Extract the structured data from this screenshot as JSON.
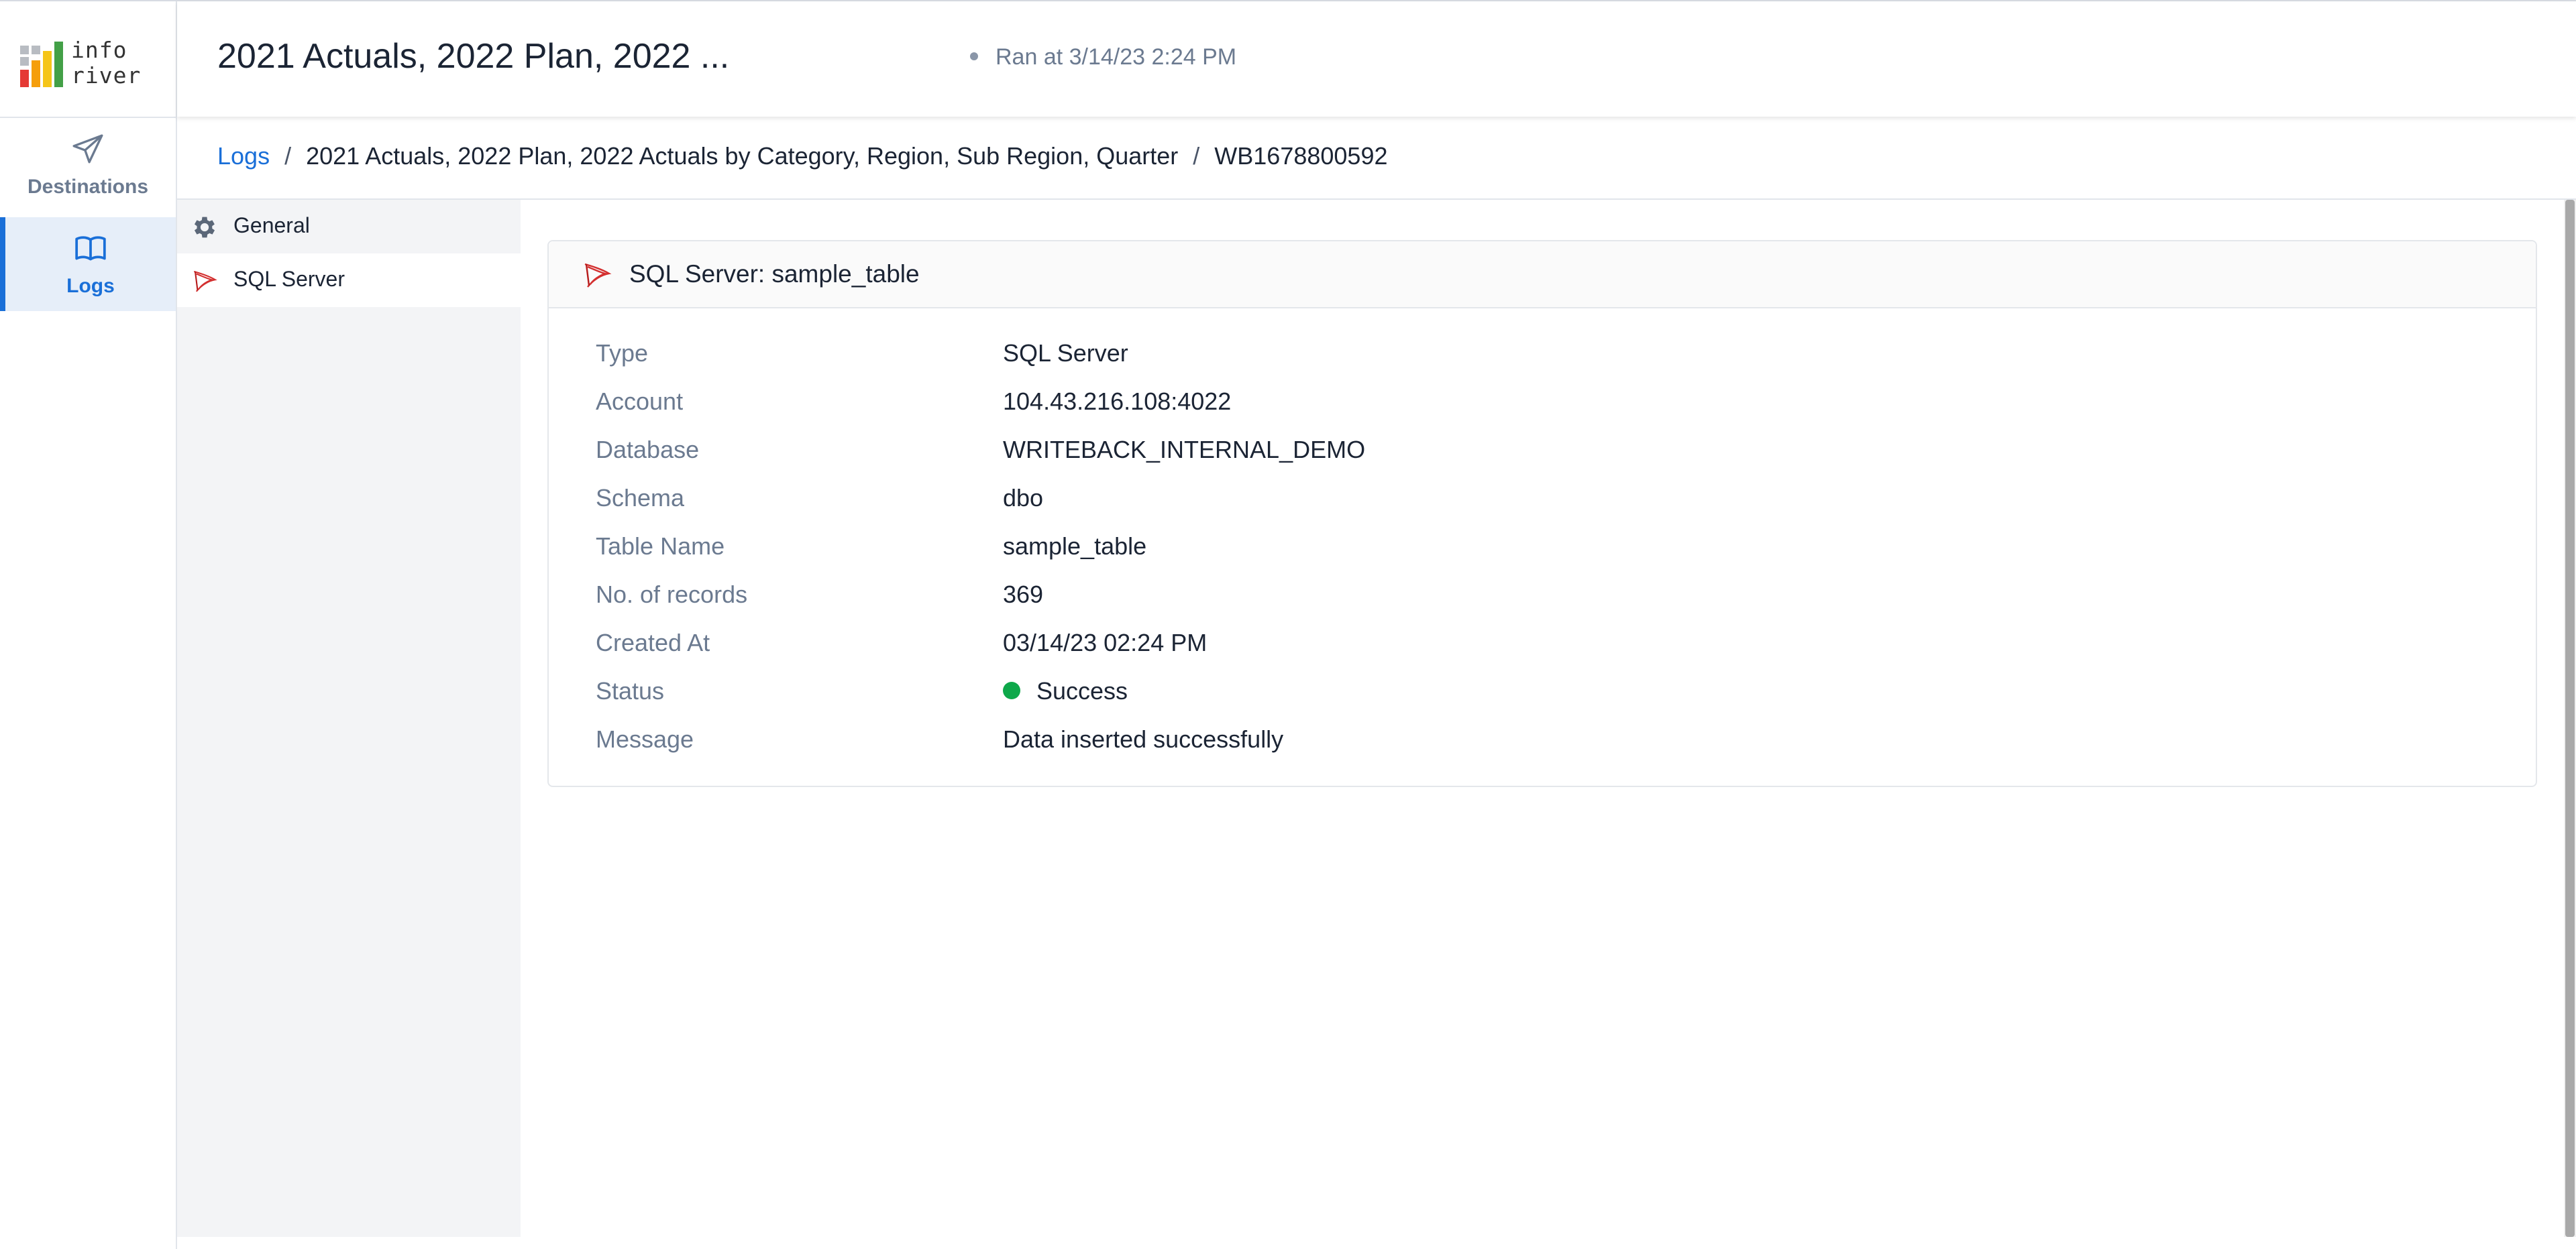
{
  "app": {
    "logo_text_line1": "info",
    "logo_text_line2": "river"
  },
  "rail": {
    "items": [
      {
        "label": "Destinations",
        "icon": "send-icon",
        "active": false
      },
      {
        "label": "Logs",
        "icon": "book-icon",
        "active": true
      }
    ]
  },
  "header": {
    "title": "2021 Actuals, 2022 Plan, 2022 ...",
    "ran_at": "Ran at 3/14/23 2:24 PM"
  },
  "breadcrumb": {
    "root": "Logs",
    "report": "2021 Actuals, 2022 Plan, 2022 Actuals by Category, Region, Sub Region, Quarter",
    "run_id": "WB1678800592"
  },
  "subnav": {
    "items": [
      {
        "label": "General",
        "icon": "gear-icon",
        "selected": false
      },
      {
        "label": "SQL Server",
        "icon": "sql-server-icon",
        "selected": true
      }
    ]
  },
  "detail": {
    "title": "SQL Server: sample_table",
    "fields": [
      {
        "key": "Type",
        "value": "SQL Server"
      },
      {
        "key": "Account",
        "value": "104.43.216.108:4022"
      },
      {
        "key": "Database",
        "value": "WRITEBACK_INTERNAL_DEMO"
      },
      {
        "key": "Schema",
        "value": "dbo"
      },
      {
        "key": "Table Name",
        "value": "sample_table"
      },
      {
        "key": "No. of records",
        "value": "369"
      },
      {
        "key": "Created At",
        "value": "03/14/23 02:24 PM"
      },
      {
        "key": "Status",
        "value": "Success"
      },
      {
        "key": "Message",
        "value": "Data inserted successfully"
      }
    ]
  },
  "colors": {
    "accent": "#1a6fd8",
    "success": "#0ea84a",
    "logo_red": "#e53935",
    "logo_orange": "#f59e0b",
    "logo_yellow": "#f5c518",
    "logo_green": "#43a047"
  }
}
